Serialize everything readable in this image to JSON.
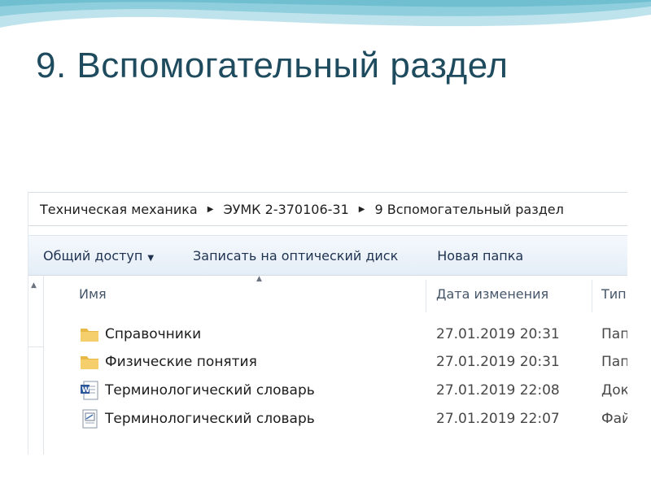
{
  "slide": {
    "title": "9. Вспомогательный раздел"
  },
  "address": {
    "crumbs": [
      "Техническая механика",
      "ЭУМК 2-370106-31",
      "9 Вспомогательный раздел"
    ]
  },
  "toolbar": {
    "share_label": "Общий доступ",
    "burn_label": "Записать на оптический диск",
    "new_folder_label": "Новая папка"
  },
  "columns": {
    "name": "Имя",
    "date": "Дата изменения",
    "type": "Тип"
  },
  "files": [
    {
      "name": "Справочники",
      "date": "27.01.2019 20:31",
      "type": "Пап",
      "icon": "folder-icon"
    },
    {
      "name": "Физические понятия",
      "date": "27.01.2019 20:31",
      "type": "Пап",
      "icon": "folder-icon"
    },
    {
      "name": "Терминологический словарь",
      "date": "27.01.2019 22:08",
      "type": "Док",
      "icon": "word-document-icon"
    },
    {
      "name": "Терминологический словарь",
      "date": "27.01.2019 22:07",
      "type": "Фай",
      "icon": "text-file-icon"
    }
  ],
  "colors": {
    "title": "#1f4b5e",
    "toolbar_text": "#1e3250",
    "folder": "#e9b948",
    "word": "#2b579a"
  }
}
